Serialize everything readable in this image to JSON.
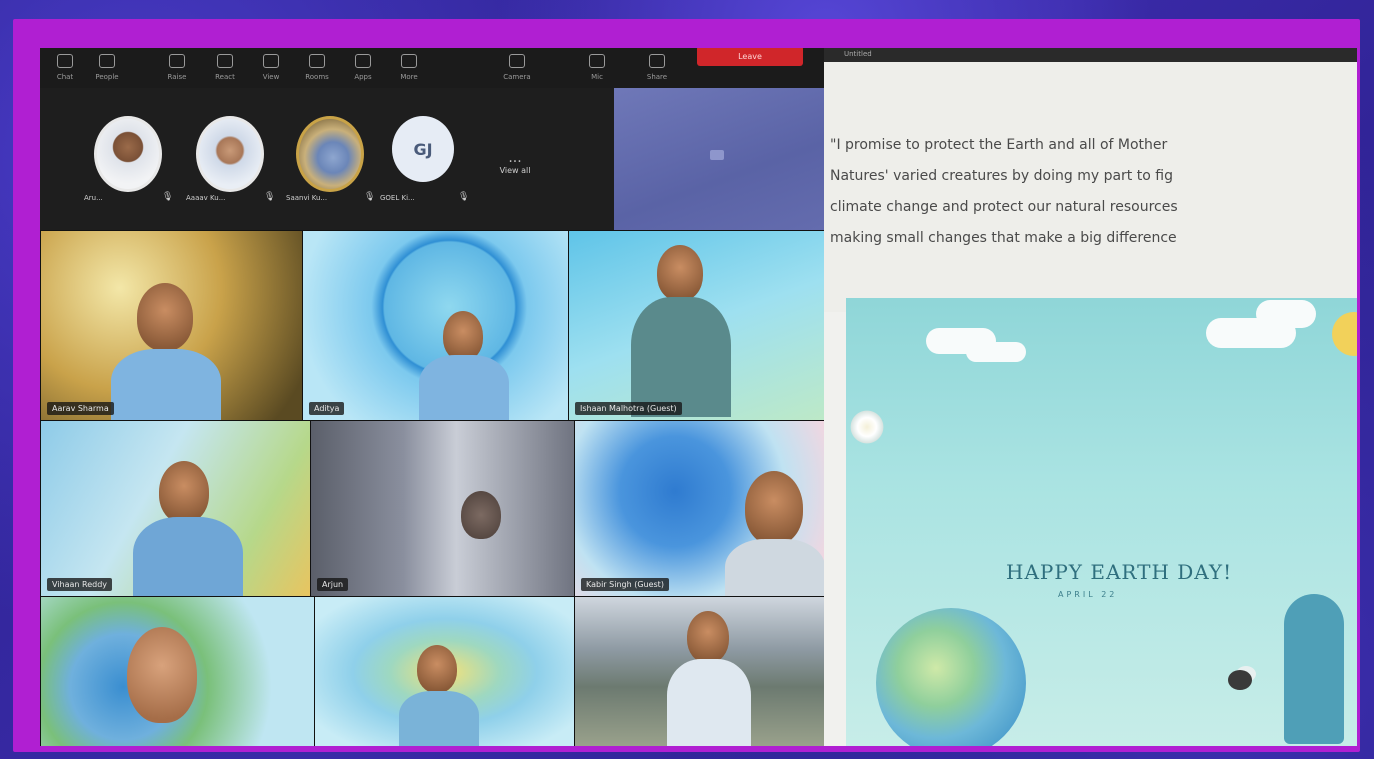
{
  "colors": {
    "frame": "#b01fd2",
    "background": "#2a1f8a",
    "leave_button": "#d0262a"
  },
  "toolbar": {
    "buttons": [
      {
        "label": "Chat",
        "icon": "chat-icon"
      },
      {
        "label": "People",
        "icon": "people-icon"
      },
      {
        "label": "Raise",
        "icon": "raise-hand-icon"
      },
      {
        "label": "React",
        "icon": "react-icon"
      },
      {
        "label": "View",
        "icon": "view-icon"
      },
      {
        "label": "Rooms",
        "icon": "rooms-icon"
      },
      {
        "label": "Apps",
        "icon": "apps-icon"
      },
      {
        "label": "More",
        "icon": "more-icon"
      },
      {
        "label": "Camera",
        "icon": "camera-icon"
      },
      {
        "label": "Mic",
        "icon": "mic-icon"
      },
      {
        "label": "Share",
        "icon": "share-icon"
      }
    ],
    "leave_label": "Leave"
  },
  "roster": {
    "people": [
      {
        "name": "Aru...",
        "initials": ""
      },
      {
        "name": "Aaaav Ku...",
        "initials": ""
      },
      {
        "name": "Saanvi Ku...",
        "initials": ""
      },
      {
        "name": "GOEL Ki...",
        "initials": "GJ"
      }
    ],
    "more_label": "View all"
  },
  "grid": {
    "tiles": [
      {
        "name": "Aarav Sharma"
      },
      {
        "name": "Aditya"
      },
      {
        "name": "Ishaan Malhotra (Guest)"
      },
      {
        "name": "Vihaan Reddy"
      },
      {
        "name": "Arjun"
      },
      {
        "name": "Kabir Singh (Guest)"
      },
      {
        "name": ""
      },
      {
        "name": ""
      },
      {
        "name": ""
      }
    ]
  },
  "slide": {
    "tab_label": "Untitled",
    "pledge_lines": [
      "\"I promise to protect the Earth and all of Mother",
      "Natures' varied creatures by doing my part to fig",
      "climate change and protect our natural resources",
      "making small changes that make a big difference"
    ],
    "title": "HAPPY EARTH DAY!",
    "subtitle": "APRIL 22"
  }
}
